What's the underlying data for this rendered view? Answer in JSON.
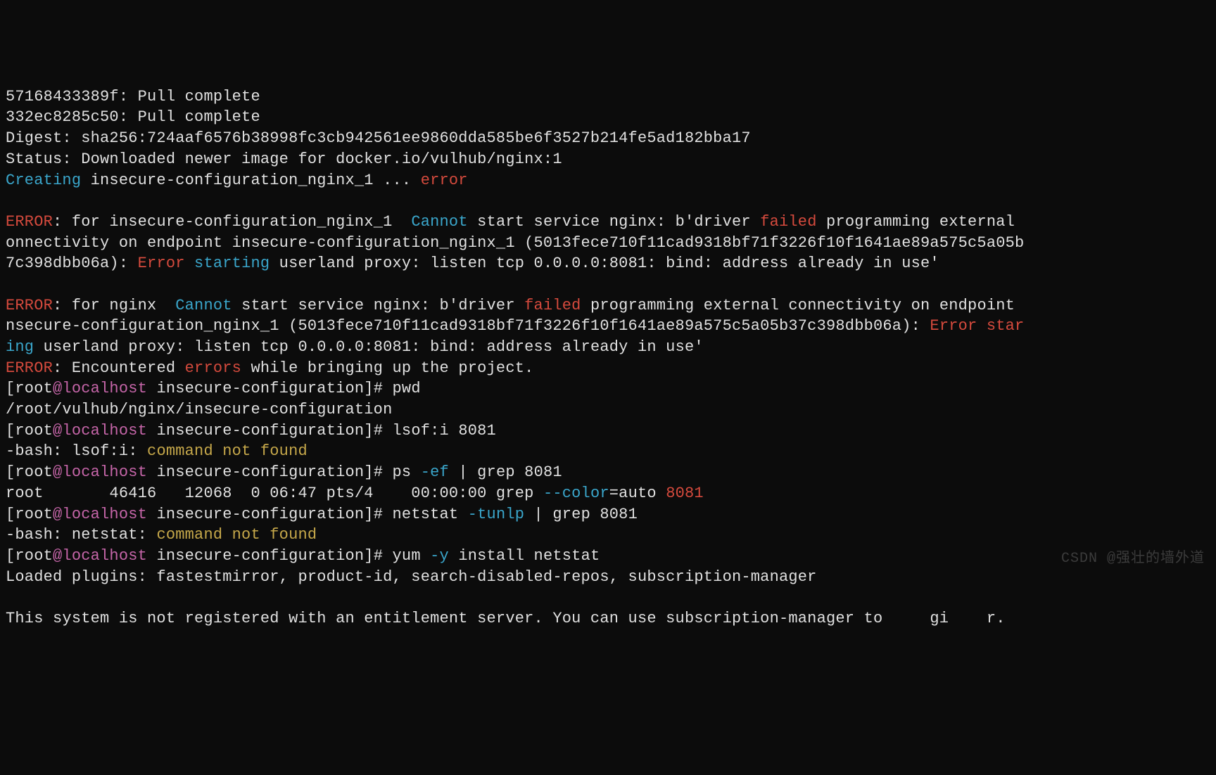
{
  "lines": {
    "pull1": "57168433389f: Pull complete",
    "pull2": "332ec8285c50: Pull complete",
    "digest": "Digest: sha256:724aaf6576b38998fc3cb942561ee9860dda585be6f3527b214fe5ad182bba17",
    "status": "Status: Downloaded newer image for docker.io/vulhub/nginx:1",
    "creating_lbl": "Creating",
    "creating_name": " insecure-configuration_nginx_1 ... ",
    "creating_err": "error",
    "err_lbl": "ERROR",
    "err1_a": ": for insecure-configuration_nginx_1  ",
    "cannot": "Cannot",
    "err1_b": " start service nginx: b'driver ",
    "failed": "failed",
    "err1_c": " programming external ",
    "err1_wrap1": "onnectivity on endpoint insecure-configuration_nginx_1 (5013fece710f11cad9318bf71f3226f10f1641ae89a575c5a05b",
    "err1_wrap2a": "7c398dbb06a): ",
    "error_word": "Error",
    "starting_word": " starting",
    "err1_wrap2b": " userland proxy: listen tcp 0.0.0.0:8081: bind: address already in use'",
    "err2_a": ": for nginx  ",
    "err2_b": " start service nginx: b'driver ",
    "err2_c": " programming external connectivity on endpoint ",
    "err2_wrap1": "nsecure-configuration_nginx_1 (5013fece710f11cad9318bf71f3226f10f1641ae89a575c5a05b37c398dbb06a): ",
    "err2_wrap1_tail": " star",
    "err2_wrap2a": "ing",
    "err2_wrap2b": " userland proxy: listen tcp 0.0.0.0:8081: bind: address already in use'",
    "err3_a": ": Encountered ",
    "errors_word": "errors",
    "err3_b": " while bringing up the project.",
    "prompt_open": "[root",
    "prompt_at": "@",
    "prompt_host": "localhost",
    "prompt_dir": " insecure-configuration]# ",
    "cmd_pwd": "pwd",
    "pwd_out": "/root/vulhub/nginx/insecure-configuration",
    "cmd_lsof": "lsof:i 8081",
    "lsof_err_a": "-bash: lsof:i: ",
    "cmd_not_found": "command not found",
    "cmd_ps_a": "ps ",
    "cmd_ps_flag": "-ef",
    "cmd_ps_b": " | grep 8081",
    "ps_out_a": "root       46416   12068  0 06:47 pts/4    00:00:00 grep ",
    "ps_out_flag": "--color",
    "ps_out_b": "=auto ",
    "ps_out_port": "8081",
    "cmd_netstat_a": "netstat ",
    "cmd_netstat_flag": "-tunlp",
    "cmd_netstat_b": " | grep 8081",
    "netstat_err_a": "-bash: netstat: ",
    "cmd_yum_a": "yum ",
    "cmd_yum_flag": "-y",
    "cmd_yum_b": " install netstat",
    "yum_out1": "Loaded plugins: fastestmirror, product-id, search-disabled-repos, subscription-manager",
    "yum_out2": "This system is not registered with an entitlement server. You can use subscription-manager to     gi    r."
  },
  "watermark": "CSDN @强壮的墙外道"
}
